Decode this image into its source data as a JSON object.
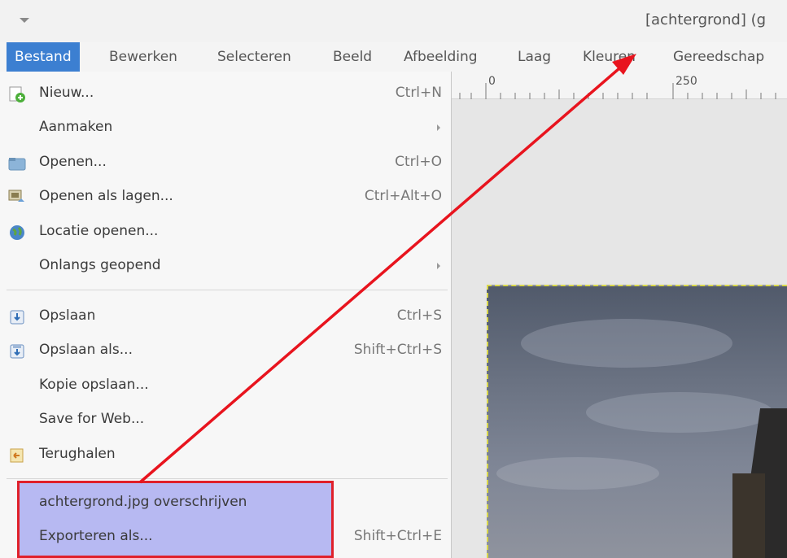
{
  "window": {
    "title": "[achtergrond] (g"
  },
  "menubar": {
    "items": [
      "Bestand",
      "Bewerken",
      "Selecteren",
      "Beeld",
      "Afbeelding",
      "Laag",
      "Kleuren",
      "Gereedschap"
    ],
    "active": "Bestand"
  },
  "ruler": {
    "labels": [
      "0",
      "250"
    ]
  },
  "file_menu": {
    "items": [
      {
        "label": "Nieuw...",
        "shortcut": "Ctrl+N",
        "icon": "new-image-icon"
      },
      {
        "label": "Aanmaken",
        "shortcut": "",
        "submenu": true
      },
      {
        "label": "Openen...",
        "shortcut": "Ctrl+O",
        "icon": "folder-icon"
      },
      {
        "label": "Openen als lagen...",
        "shortcut": "Ctrl+Alt+O",
        "icon": "open-as-layers-icon"
      },
      {
        "label": "Locatie openen...",
        "shortcut": "",
        "icon": "globe-icon"
      },
      {
        "label": "Onlangs geopend",
        "shortcut": "",
        "submenu": true
      },
      {
        "label": "Opslaan",
        "shortcut": "Ctrl+S",
        "icon": "save-icon"
      },
      {
        "label": "Opslaan als...",
        "shortcut": "Shift+Ctrl+S",
        "icon": "save-as-icon"
      },
      {
        "label": "Kopie opslaan...",
        "shortcut": ""
      },
      {
        "label": "Save for Web...",
        "shortcut": ""
      },
      {
        "label": "Terughalen",
        "shortcut": "",
        "icon": "revert-icon"
      },
      {
        "label": "achtergrond.jpg overschrijven",
        "shortcut": ""
      },
      {
        "label": "Exporteren als...",
        "shortcut": "Shift+Ctrl+E"
      }
    ]
  },
  "annotation": {
    "box_color": "#e0202a",
    "highlight_color": "#b7b9f2",
    "arrow_color": "#e8141e"
  },
  "colors": {
    "menu_active": "#3c7fd1",
    "menu_bg": "#f7f7f7"
  }
}
